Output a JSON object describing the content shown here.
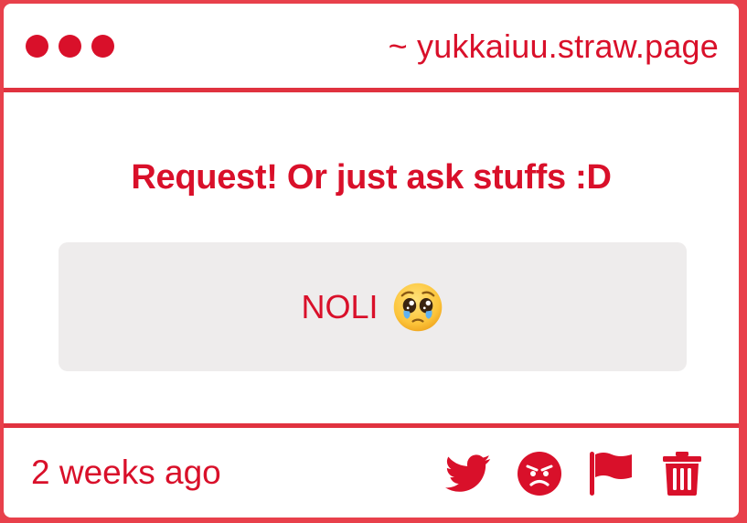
{
  "window": {
    "url": "~ yukkaiuu.straw.page"
  },
  "main": {
    "heading": "Request! Or just ask stuffs :D",
    "message": {
      "text": "NOLI",
      "emoji": "pleading-face-with-tears-icon"
    }
  },
  "footer": {
    "timestamp": "2 weeks ago",
    "actions": [
      {
        "icon": "twitter-icon"
      },
      {
        "icon": "angry-face-icon"
      },
      {
        "icon": "flag-icon"
      },
      {
        "icon": "trash-icon"
      }
    ]
  },
  "colors": {
    "accent": "#d9102a",
    "border": "#e0323f",
    "message_bg": "#eeecec"
  }
}
